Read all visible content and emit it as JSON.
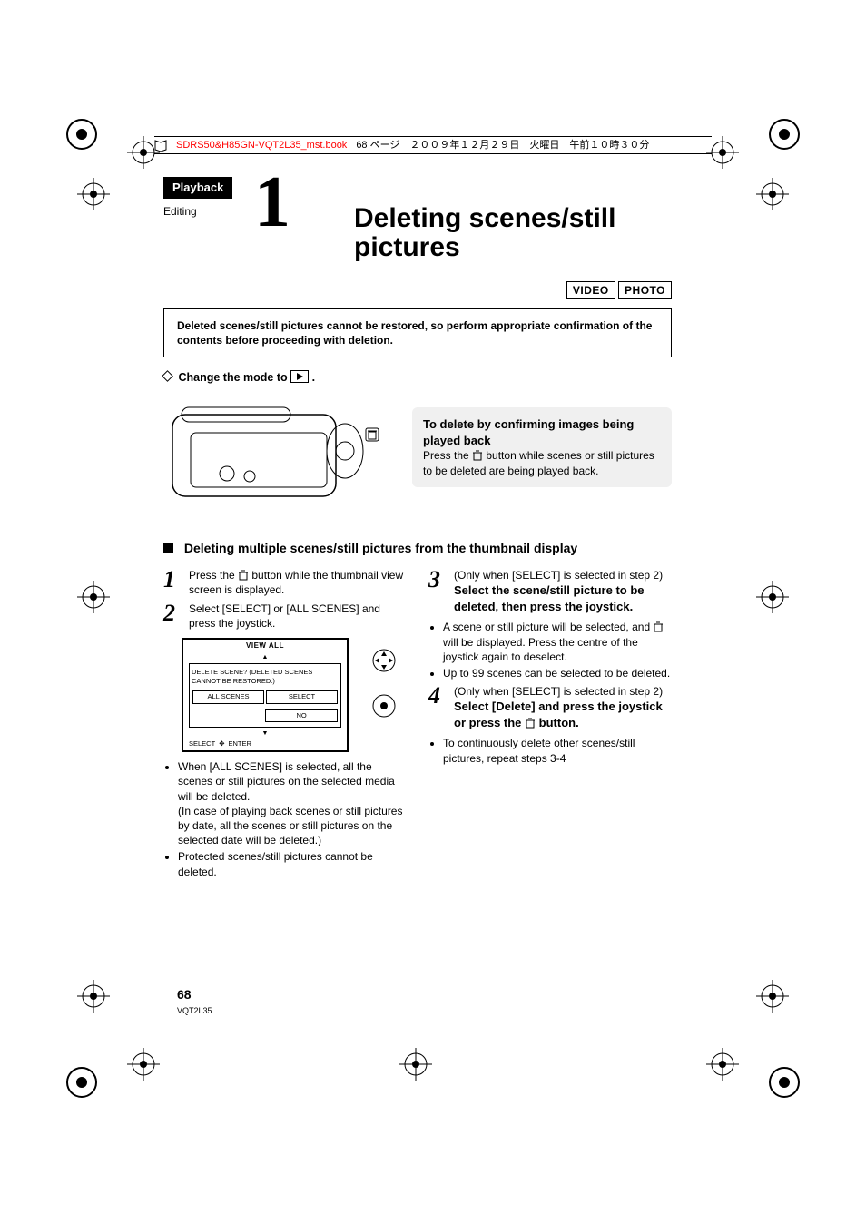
{
  "header": {
    "file": "SDRS50&H85GN-VQT2L35_mst.book",
    "pageinfo": "68 ページ　２００９年１２月２９日　火曜日　午前１０時３０分"
  },
  "tab": "Playback",
  "editing_label": "Editing",
  "chapter_num": "1",
  "title_line1": "Deleting scenes/still",
  "title_line2": "pictures",
  "mode_badges": {
    "video": "VIDEO",
    "photo": "PHOTO"
  },
  "warning": "Deleted scenes/still pictures cannot be restored, so perform appropriate confirmation of the contents before proceeding with deletion.",
  "change_mode_pre": "Change the mode to ",
  "change_mode_post": " .",
  "callout": {
    "title": "To delete by confirming images being played back",
    "body_pre": "Press the ",
    "body_post": " button while scenes or still pictures to be deleted are being played back."
  },
  "section_heading": "Deleting multiple scenes/still pictures from the thumbnail display",
  "steps": {
    "s1": {
      "num": "1",
      "pre": "Press the ",
      "post": " button while the thumbnail view screen is displayed."
    },
    "s2": {
      "num": "2",
      "text": "Select [SELECT] or [ALL SCENES] and press the joystick."
    },
    "s3": {
      "num": "3",
      "cond": "(Only when [SELECT] is selected in step 2)",
      "bold": "Select the scene/still picture to be deleted, then press the joystick."
    },
    "s4": {
      "num": "4",
      "cond": "(Only when [SELECT] is selected in step 2)",
      "bold_pre": "Select [Delete] and press the joystick or press the ",
      "bold_post": " button."
    }
  },
  "left_notes": {
    "n1": "When [ALL SCENES] is selected, all the scenes or still pictures on the selected media will be deleted.",
    "n1b": "(In case of playing back scenes or still pictures by date, all the scenes or still pictures on the selected date will be deleted.)",
    "n2": "Protected scenes/still pictures cannot be deleted."
  },
  "right_notes": {
    "r1_pre": "A scene or still picture will be selected, and ",
    "r1_post": " will be displayed. Press the centre of the joystick again to deselect.",
    "r2": "Up to 99 scenes can be selected to be deleted.",
    "r3": "To continuously delete other scenes/still pictures, repeat steps 3-4"
  },
  "screen": {
    "title": "VIEW ALL",
    "msg": "DELETE SCENE? (DELETED SCENES CANNOT BE RESTORED.)",
    "btn_all": "ALL SCENES",
    "btn_select": "SELECT",
    "btn_no": "NO",
    "foot_select": "SELECT",
    "foot_enter": "ENTER"
  },
  "page_number": "68",
  "doc_id": "VQT2L35"
}
